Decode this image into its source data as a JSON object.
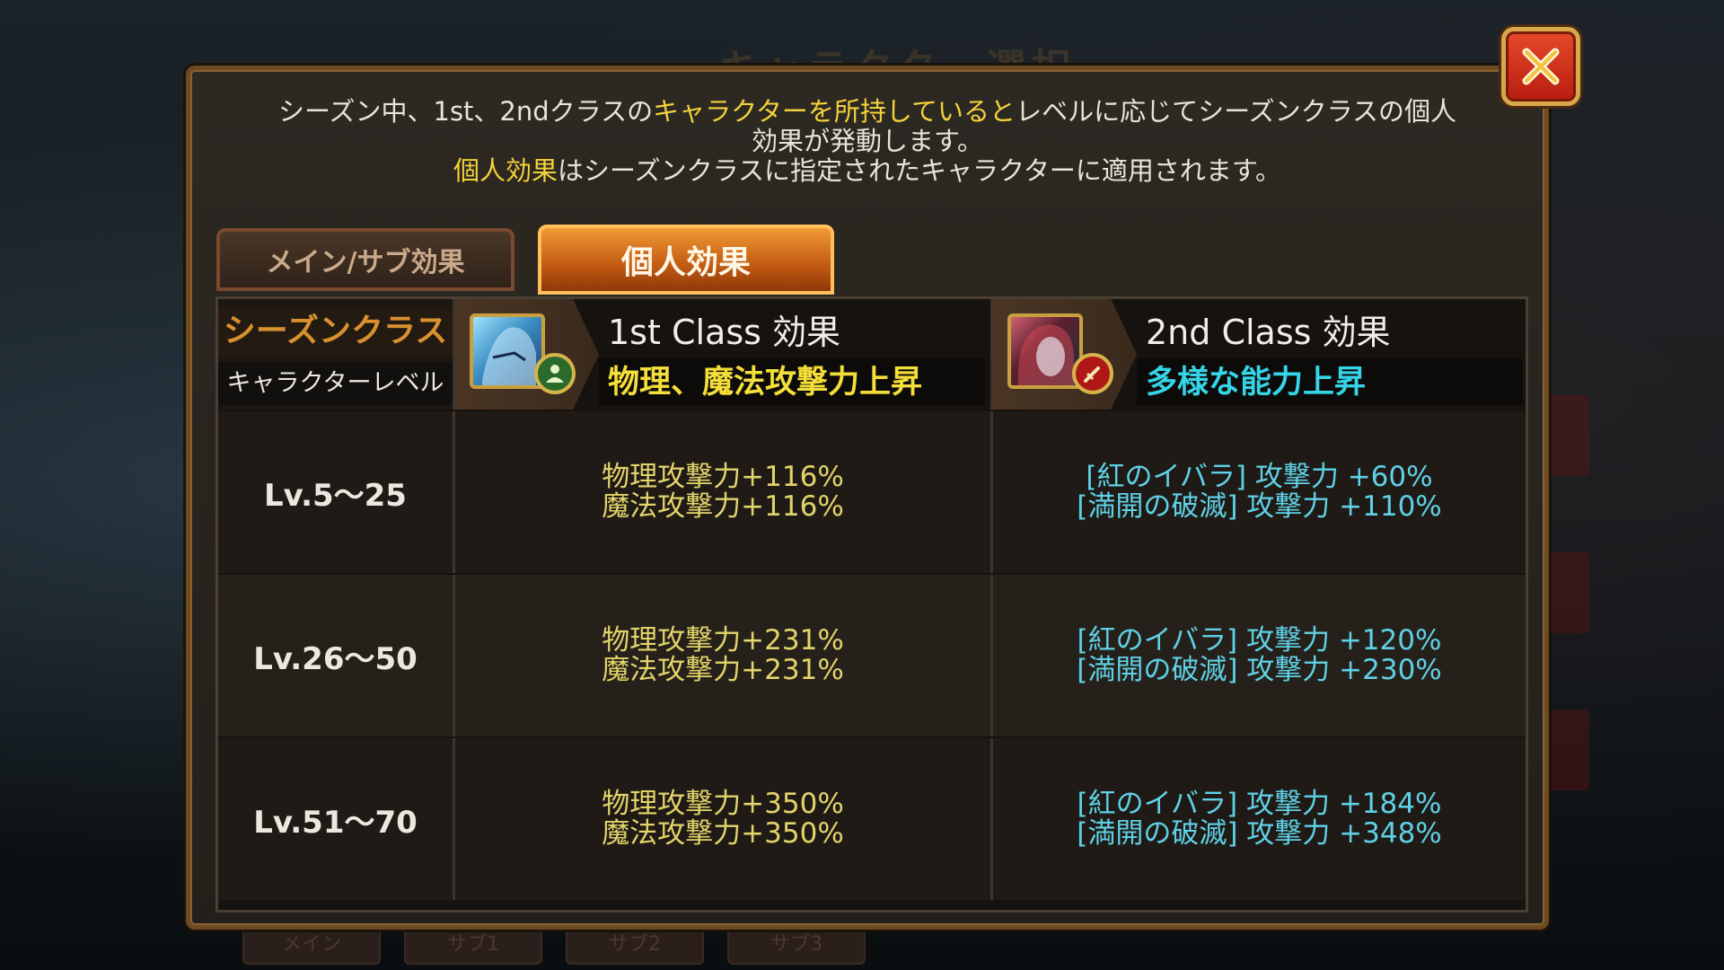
{
  "background": {
    "title": "キャラクター選択",
    "tabs": [
      "メイン",
      "サブ1",
      "サブ2",
      "サブ3"
    ]
  },
  "close": {
    "icon": "close-x-icon",
    "color": "#d82b16"
  },
  "intro": {
    "line1_a": "シーズン中、1st、2ndクラスの",
    "line1_hl": "キャラクターを所持していると",
    "line1_b": "レベルに応じてシーズンクラスの個人",
    "line2": "効果が発動します。",
    "line3_hl": "個人効果",
    "line3_b": "はシーズンクラスに指定されたキャラクターに適用されます。"
  },
  "tabs": {
    "main_sub": "メイン/サブ効果",
    "personal": "個人効果"
  },
  "header": {
    "season_class": "シーズンクラス",
    "character_level": "キャラクターレベル",
    "class1": {
      "name": "1st Class 効果",
      "effect": "物理、魔法攻撃力上昇",
      "badge_icon": "support-class-icon"
    },
    "class2": {
      "name": "2nd Class 効果",
      "effect": "多様な能力上昇",
      "badge_icon": "sword-class-icon"
    }
  },
  "rows": [
    {
      "level": "Lv.5～25",
      "c1_l1": "物理攻撃力+116%",
      "c1_l2": "魔法攻撃力+116%",
      "c2_l1": "[紅のイバラ] 攻撃力 +60%",
      "c2_l2": "[満開の破滅] 攻撃力 +110%"
    },
    {
      "level": "Lv.26～50",
      "c1_l1": "物理攻撃力+231%",
      "c1_l2": "魔法攻撃力+231%",
      "c2_l1": "[紅のイバラ] 攻撃力 +120%",
      "c2_l2": "[満開の破滅] 攻撃力 +230%"
    },
    {
      "level": "Lv.51～70",
      "c1_l1": "物理攻撃力+350%",
      "c1_l2": "魔法攻撃力+350%",
      "c2_l1": "[紅のイバラ] 攻撃力 +184%",
      "c2_l2": "[満開の破滅] 攻撃力 +348%"
    }
  ],
  "colors": {
    "highlight": "#f3d23a",
    "class1_effect": "#f4de3a",
    "class2_effect": "#35d5e8",
    "active_tab": "#e07a1e"
  }
}
